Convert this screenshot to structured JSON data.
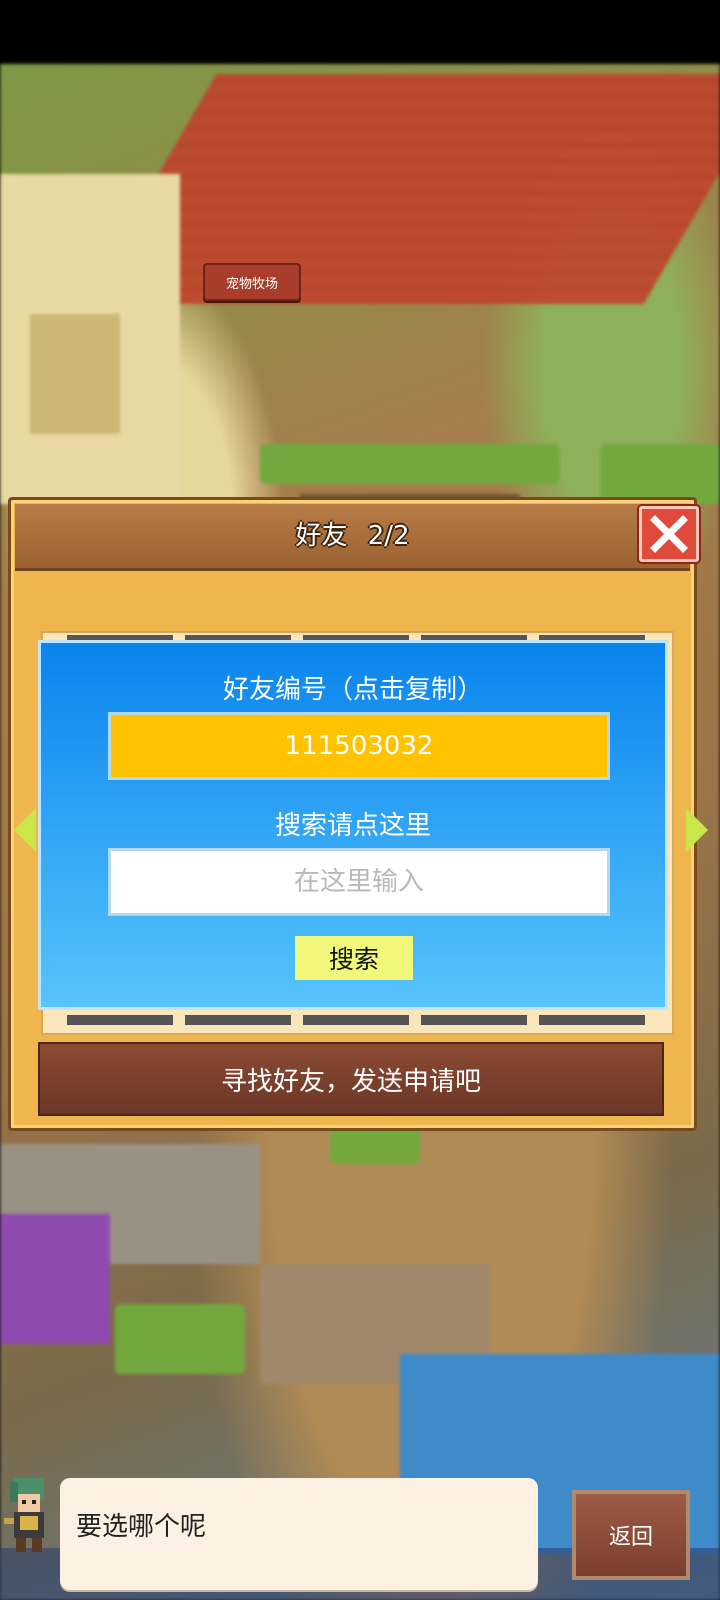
{
  "map": {
    "sign_label": "宠物牧场"
  },
  "friend_dialog": {
    "title": "好友",
    "count": "2/2",
    "close_icon": "close-icon",
    "id_panel": {
      "title": "好友编号（点击复制）",
      "friend_code": "111503032",
      "search_hint": "搜索请点这里",
      "search_placeholder": "在这里输入",
      "search_value": "",
      "search_button": "搜索"
    },
    "bottom_message": "寻找好友，发送申请吧"
  },
  "bottom": {
    "speech": "要选哪个呢",
    "back_button": "返回"
  },
  "colors": {
    "panel_blue_top": "#0a84ee",
    "panel_blue_bottom": "#57c4fb",
    "friend_code_bg": "#ffc300",
    "search_button_bg": "#f0f77a",
    "close_red": "#e04a3a",
    "dialog_wood": "#f0b64e"
  }
}
